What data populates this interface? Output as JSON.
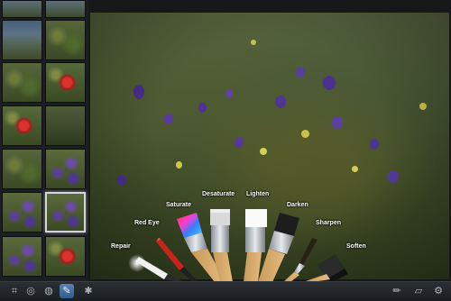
{
  "brush_labels": {
    "saturate": "Saturate",
    "desaturate": "Desaturate",
    "lighten": "Lighten",
    "darken": "Darken",
    "red_eye": "Red Eye",
    "sharpen": "Sharpen",
    "repair": "Repair",
    "soften": "Soften"
  },
  "toolbar": {
    "left_icons": [
      "crop-icon",
      "straighten-icon",
      "adjust-icon",
      "brushes-icon",
      "effects-icon"
    ],
    "right_icons": [
      "brush-tool-icon",
      "eraser-icon",
      "settings-icon"
    ],
    "active": "brushes-icon"
  },
  "colors": {
    "toolbar_active": "#3e6fa5",
    "selected_thumb_border": "#cfd6dc"
  }
}
